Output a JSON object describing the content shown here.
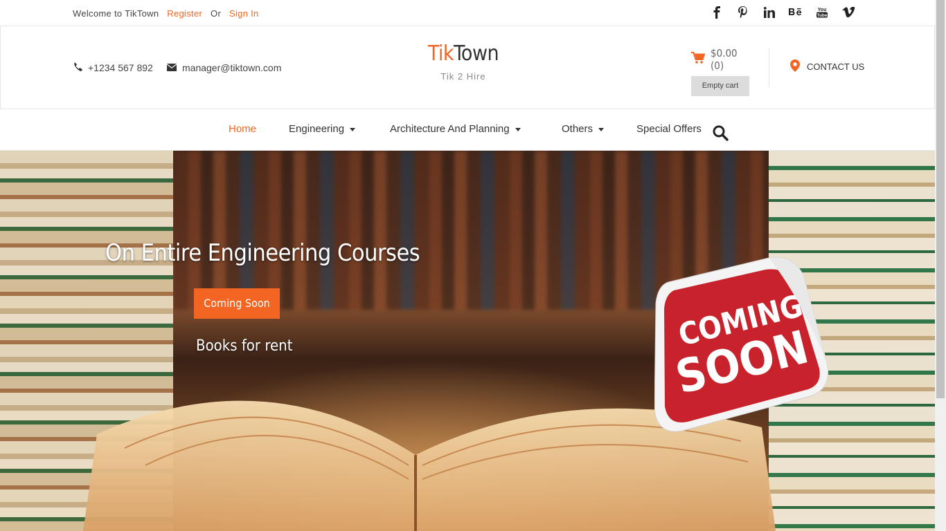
{
  "topbar": {
    "welcome": "Welcome to TikTown",
    "register": "Register",
    "or": "Or",
    "sign_in": "Sign In",
    "social": [
      "f",
      "P",
      "in",
      "Bē",
      "You\nTube",
      "v"
    ]
  },
  "header": {
    "phone": "+1234 567 892",
    "email": "manager@tiktown.com",
    "logo_tik": "Tik",
    "logo_town": "Town",
    "tagline": "Tik 2 Hire",
    "cart_total": "$0.00 (0)",
    "empty_cart": "Empty cart",
    "contact_us": "CONTACT US"
  },
  "nav": {
    "items": [
      "Home",
      "Engineering",
      "Architecture And Planning",
      "Others",
      "Special Offers"
    ]
  },
  "hero": {
    "title": "On Entire Engineering Courses",
    "button": "Coming Soon",
    "subtitle": "Books for rent",
    "badge_line1": "COMING",
    "badge_line2": "SOON"
  },
  "colors": {
    "accent": "#f26522",
    "badge_red": "#c8232c"
  }
}
